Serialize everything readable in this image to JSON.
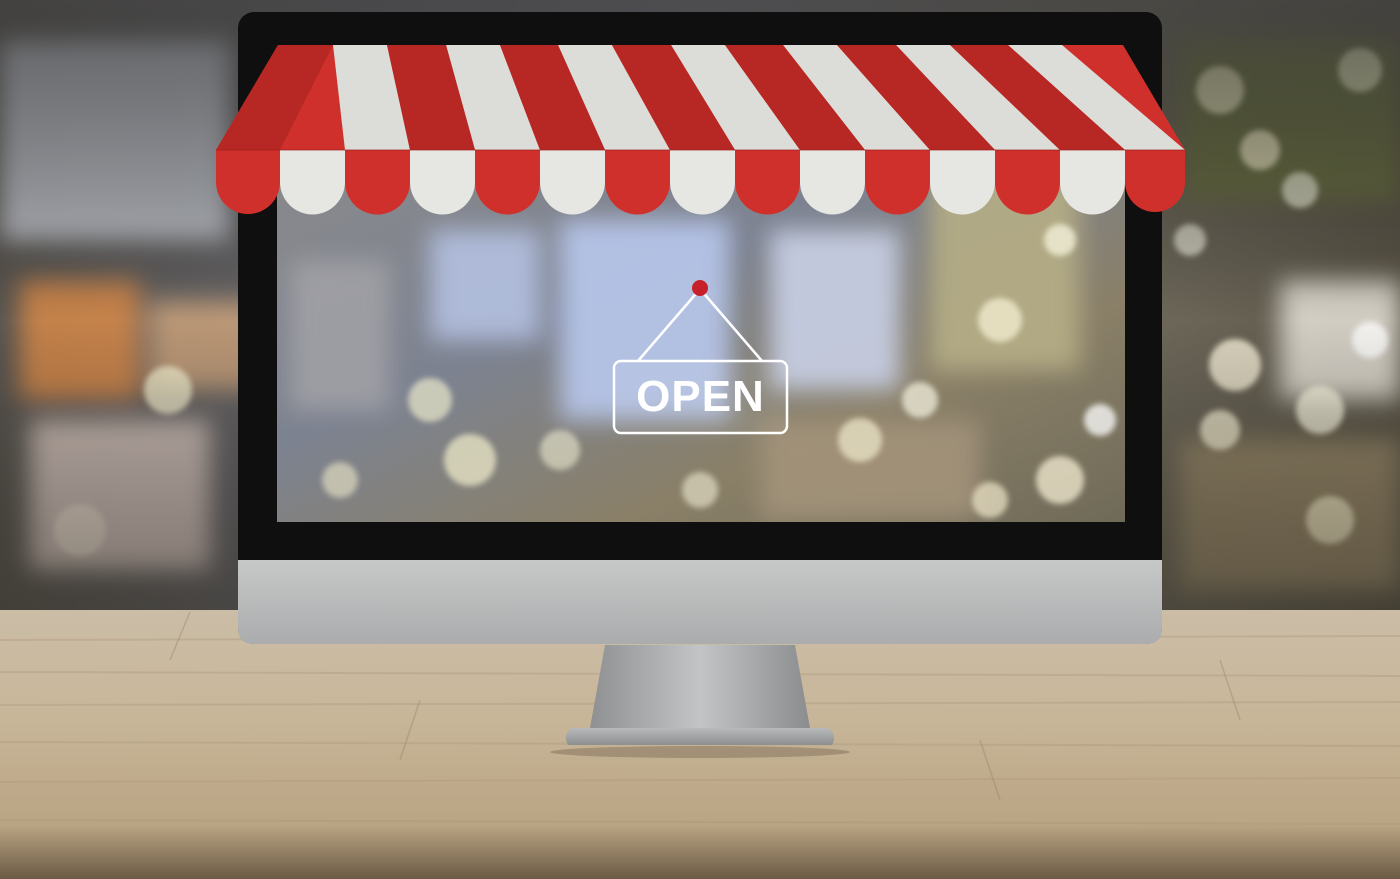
{
  "sign": {
    "text": "OPEN"
  },
  "colors": {
    "awning_red": "#d0302c",
    "awning_white": "#dcdcd8",
    "monitor_bezel": "#0f0f0f",
    "monitor_chin": "#b9bbbc",
    "table_wood": "#c8b69a",
    "pin_red": "#c8202a"
  }
}
